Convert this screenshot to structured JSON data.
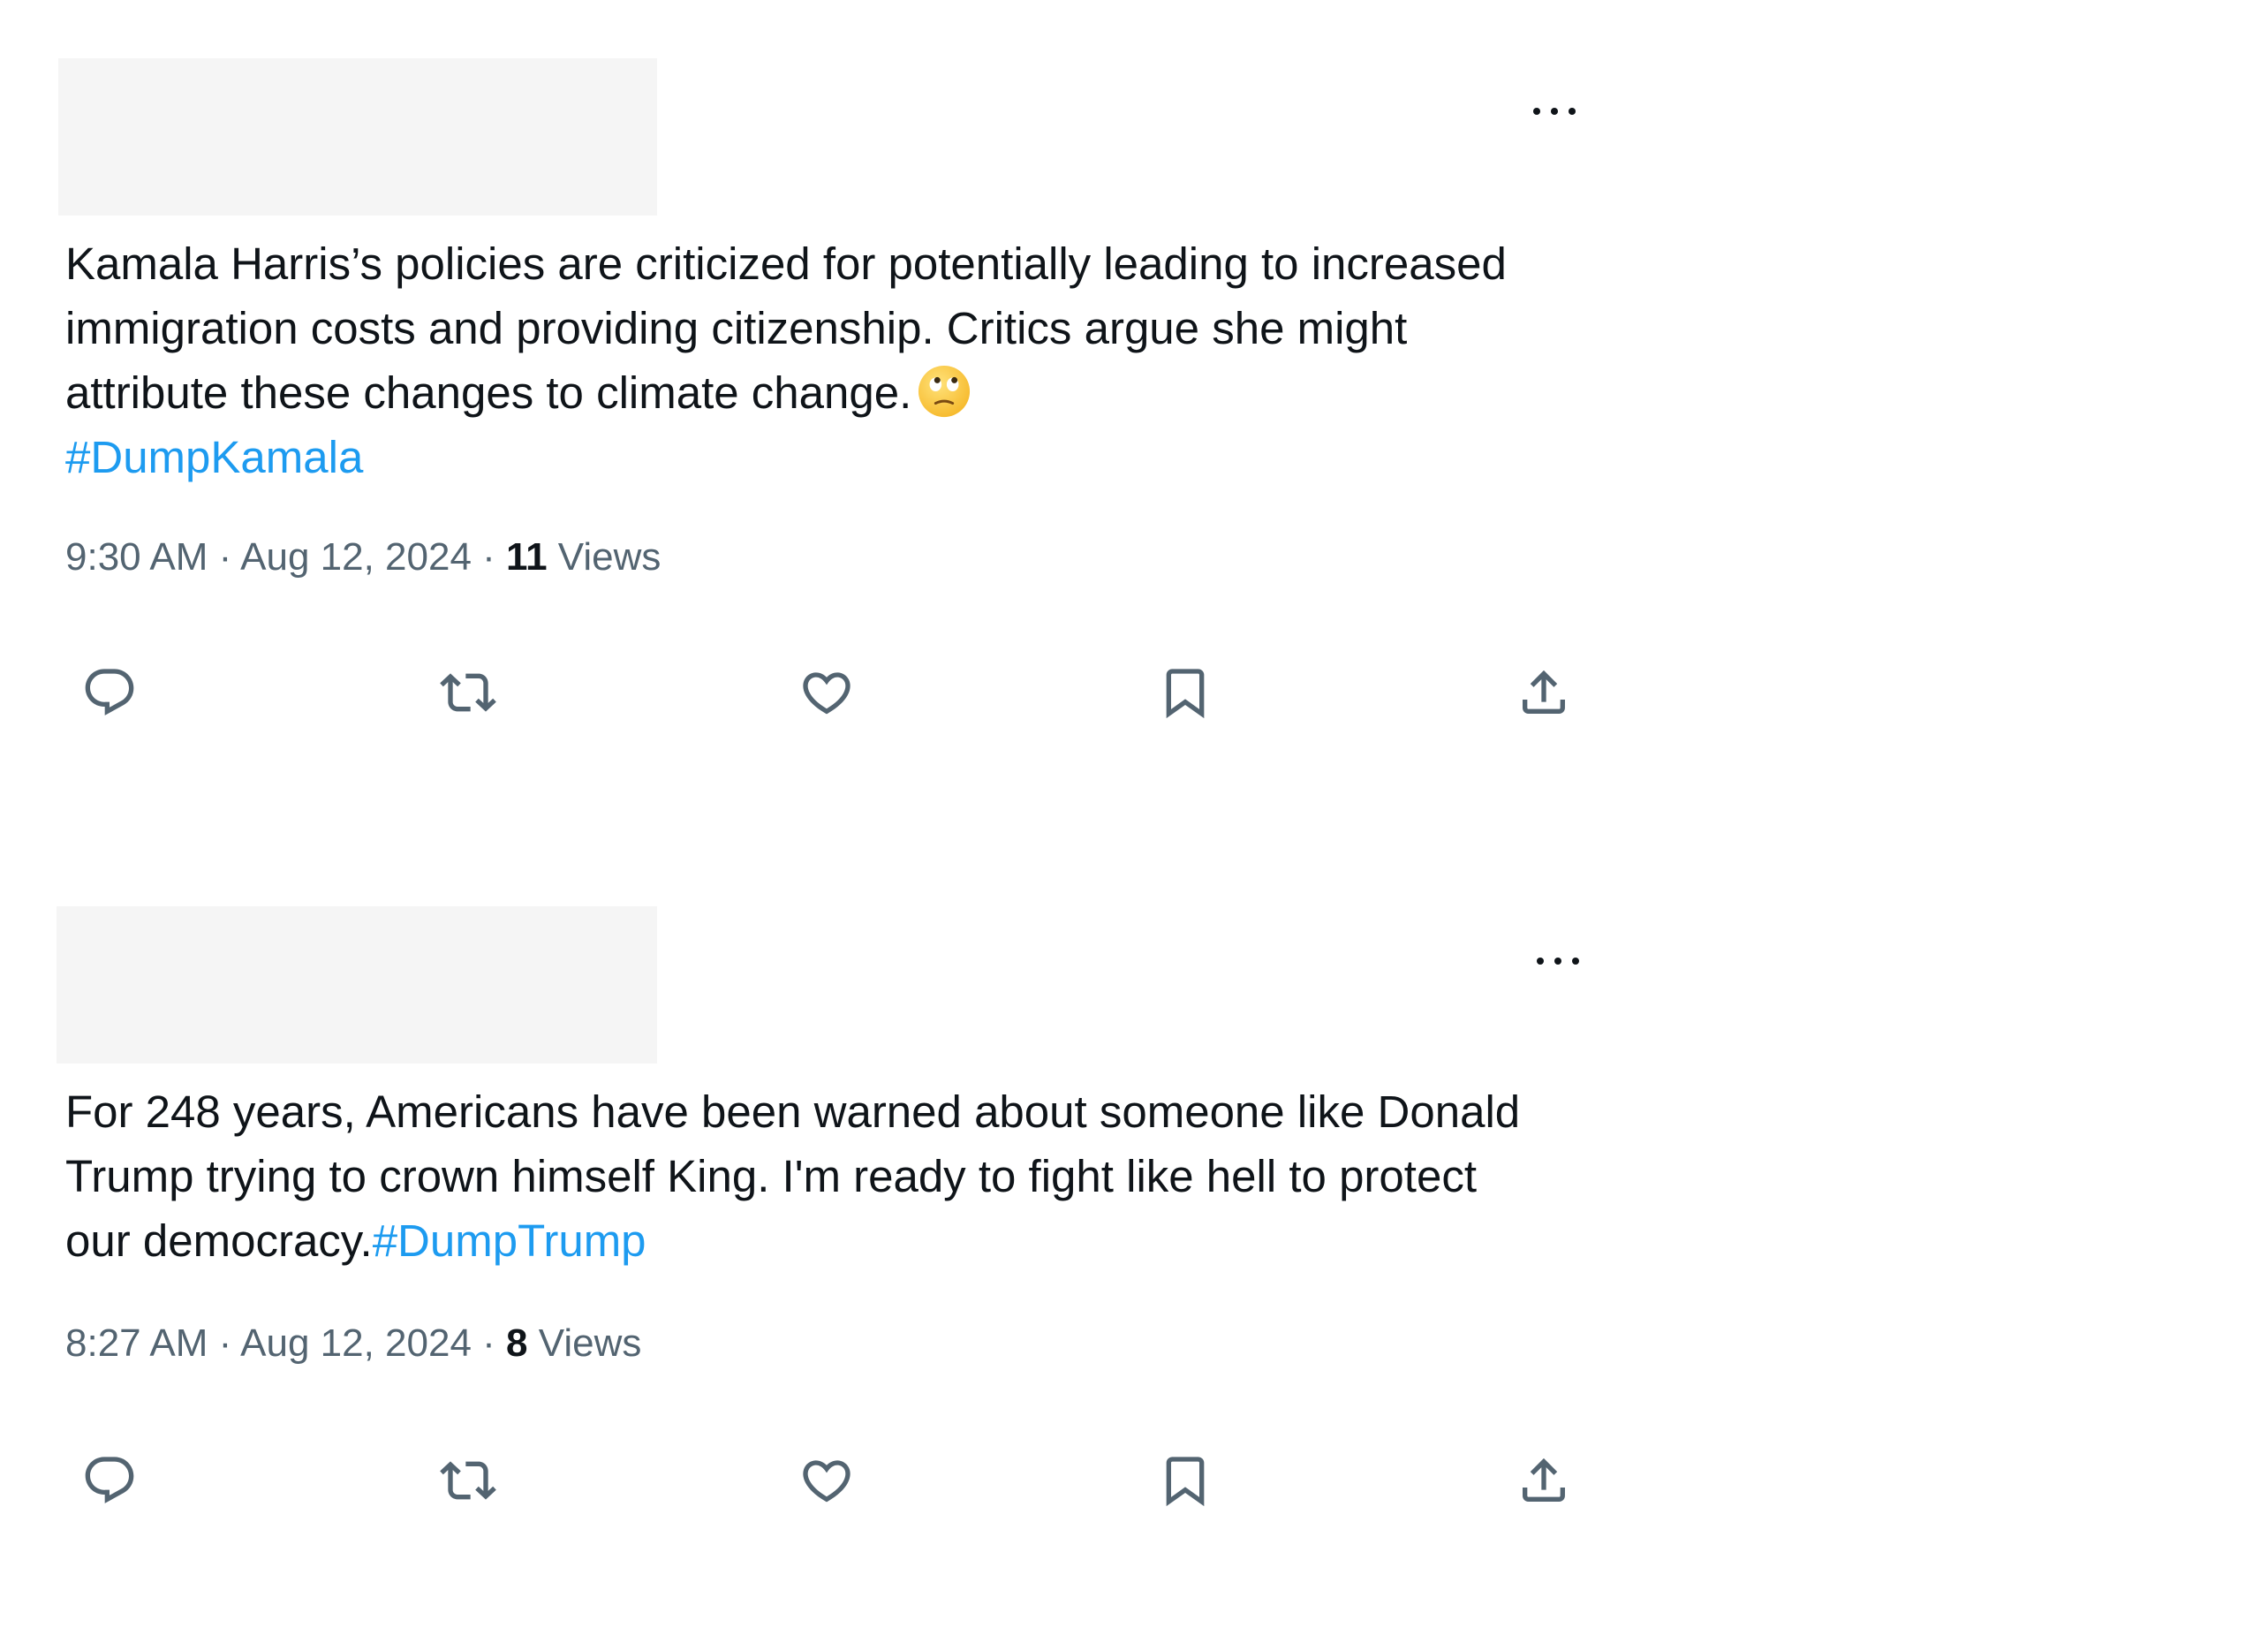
{
  "tweets": [
    {
      "text_lines": [
        "Kamala Harris’s policies are criticized for potentially leading to increased",
        "immigration costs and providing citizenship. Critics argue she might",
        "attribute these changes to climate change."
      ],
      "emoji": "face-with-rolling-eyes",
      "hashtag": "#DumpKamala",
      "time": "9:30 AM",
      "date": "Aug 12, 2024",
      "separator": "·",
      "view_count": "11",
      "views_label": "Views"
    },
    {
      "text_lines": [
        "For 248 years, Americans have been warned about someone like Donald",
        "Trump trying to crown himself King. I'm ready to fight like hell to protect",
        "our democracy."
      ],
      "hashtag": "#DumpTrump",
      "time": "8:27 AM",
      "date": "Aug 12, 2024",
      "separator": "·",
      "view_count": "8",
      "views_label": "Views"
    }
  ],
  "actions": [
    "reply-icon",
    "retweet-icon",
    "like-icon",
    "bookmark-icon",
    "share-icon"
  ],
  "colors": {
    "text": "#0f1419",
    "secondary": "#536471",
    "hashtag": "#1d9bf0",
    "redacted": "#f5f5f5"
  }
}
